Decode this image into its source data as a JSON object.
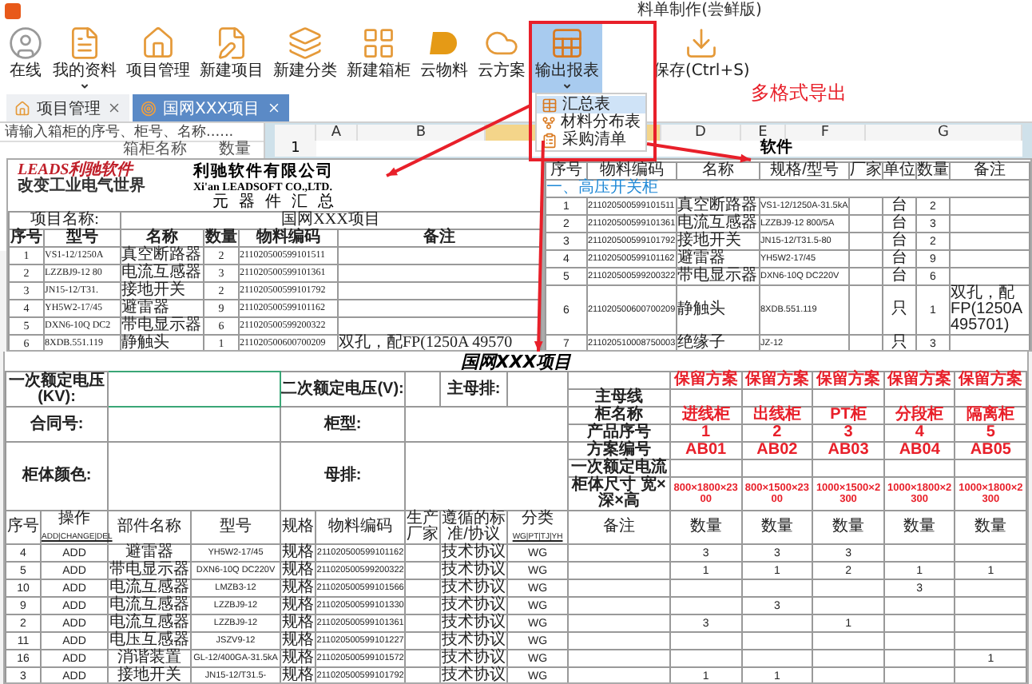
{
  "window": {
    "title": "料单制作(尝鲜版)"
  },
  "toolbar": [
    {
      "label": "在线",
      "dropdown": false,
      "selected": false
    },
    {
      "label": "我的资料",
      "dropdown": true,
      "selected": false
    },
    {
      "label": "项目管理",
      "dropdown": false,
      "selected": false
    },
    {
      "label": "新建项目",
      "dropdown": false,
      "selected": false
    },
    {
      "label": "新建分类",
      "dropdown": false,
      "selected": false
    },
    {
      "label": "新建箱柜",
      "dropdown": false,
      "selected": false
    },
    {
      "label": "云物料",
      "dropdown": false,
      "selected": false
    },
    {
      "label": "云方案",
      "dropdown": false,
      "selected": false
    },
    {
      "label": "输出报表",
      "dropdown": true,
      "selected": true
    },
    {
      "label": "保存(Ctrl+S)",
      "dropdown": false,
      "selected": false
    }
  ],
  "export_menu": [
    {
      "label": "汇总表",
      "selected": true
    },
    {
      "label": "材料分布表",
      "selected": false
    },
    {
      "label": "采购清单",
      "selected": false
    }
  ],
  "annotation": "多格式导出",
  "tabs": [
    {
      "label": "项目管理",
      "selected": false
    },
    {
      "label": "国网XXX项目",
      "selected": true
    }
  ],
  "cabinet_panel": {
    "search": {
      "placeholder": "请输入箱柜的序号、柜号、名称......"
    },
    "columns": [
      "箱柜名称",
      "数量"
    ]
  },
  "sheet": {
    "columns": [
      {
        "label": "A",
        "selected": false
      },
      {
        "label": "B",
        "selected": false
      },
      {
        "selected": true
      },
      {
        "label": "D",
        "selected": false
      },
      {
        "label": "E",
        "selected": false
      },
      {
        "label": "F",
        "selected": false
      },
      {
        "label": "G",
        "selected": false
      }
    ],
    "row_number": "1",
    "cell_text": "软件"
  },
  "summary_doc": {
    "logo": "LEADS利驰软件",
    "slogan": "改变工业电气世界",
    "company": "利驰软件有限公司",
    "company_en": "Xi'an LEADSOFT CO.,LTD.",
    "title": "元 器 件 汇 总",
    "project_label": "项目名称:",
    "project": "国网XXX项目",
    "columns": [
      "序号",
      "型号",
      "名称",
      "数量",
      "物料编码",
      "备注"
    ],
    "rows": [
      {
        "no": "1",
        "model": "VS1-12/1250A",
        "name": "真空断路器",
        "qty": "2",
        "code": "211020500599101511"
      },
      {
        "no": "2",
        "model": "LZZBJ9-12 80",
        "name": "电流互感器",
        "qty": "3",
        "code": "211020500599101361"
      },
      {
        "no": "3",
        "model": "JN15-12/T31.",
        "name": "接地开关",
        "qty": "2",
        "code": "211020500599101792"
      },
      {
        "no": "4",
        "model": "YH5W2-17/45",
        "name": "避雷器",
        "qty": "9",
        "code": "211020500599101162"
      },
      {
        "no": "5",
        "model": "DXN6-10Q DC2",
        "name": "带电显示器",
        "qty": "6",
        "code": "211020500599200322"
      },
      {
        "no": "6",
        "model": "8XDB.551.119",
        "name": "静触头",
        "qty": "1",
        "code": "211020500600700209",
        "note": "双孔，配FP(1250A 49570"
      }
    ]
  },
  "distribution_doc": {
    "columns": [
      "序号",
      "物料编码",
      "名称",
      "规格/型号",
      "厂家",
      "单位",
      "数量",
      "备注"
    ],
    "section": "一、高压开关柜",
    "rows": [
      {
        "no": "1",
        "code": "211020500599101511",
        "name": "真空断路器",
        "model": "VS1-12/1250A-31.5kA",
        "unit": "台",
        "qty": "2"
      },
      {
        "no": "2",
        "code": "211020500599101361",
        "name": "电流互感器",
        "model": "LZZBJ9-12 800/5A",
        "unit": "台",
        "qty": "3"
      },
      {
        "no": "3",
        "code": "211020500599101792",
        "name": "接地开关",
        "model": "JN15-12/T31.5-80",
        "unit": "台",
        "qty": "2"
      },
      {
        "no": "4",
        "code": "211020500599101162",
        "name": "避雷器",
        "model": "YH5W2-17/45",
        "unit": "台",
        "qty": "9"
      },
      {
        "no": "5",
        "code": "211020500599200322",
        "name": "带电显示器",
        "model": "DXN6-10Q DC220V",
        "unit": "台",
        "qty": "6"
      },
      {
        "no": "6",
        "code": "211020500600700209",
        "name": "静触头",
        "model": "8XDB.551.119",
        "unit": "只",
        "qty": "1",
        "note": "双孔，配FP(1250A 495701)"
      },
      {
        "no": "7",
        "code": "211020510008750003",
        "name": "绝缘子",
        "model": "JZ-12",
        "unit": "只",
        "qty": "3"
      }
    ]
  },
  "purchase_doc": {
    "title": "国网XXX项目",
    "info": [
      [
        "一次额定电压(KV):",
        "二次额定电压(V):",
        "主母排:"
      ],
      [
        "合同号:",
        "柜型:"
      ],
      [
        "柜体颜色:",
        "母排:"
      ]
    ],
    "schemes": [
      "保留方案",
      "保留方案",
      "保留方案",
      "保留方案",
      "保留方案"
    ],
    "spec_rows": [
      {
        "label": "主母线",
        "values": []
      },
      {
        "label": "柜名称",
        "values": [
          "进线柜",
          "出线柜",
          "PT柜",
          "分段柜",
          "隔离柜"
        ]
      },
      {
        "label": "产品序号",
        "values": [
          "1",
          "2",
          "3",
          "4",
          "5"
        ]
      },
      {
        "label": "方案编号",
        "values": [
          "AB01",
          "AB02",
          "AB03",
          "AB04",
          "AB05"
        ]
      },
      {
        "label": "一次额定电流",
        "values": []
      },
      {
        "label": "柜体尺寸 宽×深×高",
        "values": [
          "800×1800×2300",
          "800×1500×2300",
          "1000×1500×2300",
          "1000×1800×2300",
          "1000×1800×2300"
        ]
      }
    ],
    "columns": [
      "序号",
      "操作",
      "ADD|CHANGE|DEL",
      "部件名称",
      "型号",
      "规格",
      "物料编码",
      "生产厂家",
      "遵循的标准/协议",
      "分类",
      "WG|PT|TJ|YH",
      "备注",
      "数量",
      "数量",
      "数量",
      "数量",
      "数量"
    ],
    "rows": [
      {
        "no": "4",
        "op": "ADD",
        "name": "避雷器",
        "model": "YH5W2-17/45",
        "spec": "规格",
        "code": "211020500599101162",
        "standard": "技术协议",
        "category": "WG",
        "qty": {
          "s1": "3",
          "s2": "3",
          "s3": "3"
        }
      },
      {
        "no": "5",
        "op": "ADD",
        "name": "带电显示器",
        "model": "DXN6-10Q DC220V",
        "spec": "规格",
        "code": "211020500599200322",
        "standard": "技术协议",
        "category": "WG",
        "qty": {
          "s1": "1",
          "s2": "1",
          "s3": "2",
          "s4": "1",
          "s5": "1"
        }
      },
      {
        "no": "10",
        "op": "ADD",
        "name": "电流互感器",
        "model": "LMZB3-12",
        "spec": "规格",
        "code": "211020500599101566",
        "standard": "技术协议",
        "category": "WG",
        "qty": {
          "s4": "3"
        }
      },
      {
        "no": "9",
        "op": "ADD",
        "name": "电流互感器",
        "model": "LZZBJ9-12",
        "spec": "规格",
        "code": "211020500599101330",
        "standard": "技术协议",
        "category": "WG",
        "qty": {
          "s2": "3"
        }
      },
      {
        "no": "2",
        "op": "ADD",
        "name": "电流互感器",
        "model": "LZZBJ9-12",
        "spec": "规格",
        "code": "211020500599101361",
        "standard": "技术协议",
        "category": "WG",
        "qty": {
          "s1": "3",
          "s3": "1"
        }
      },
      {
        "no": "11",
        "op": "ADD",
        "name": "电压互感器",
        "model": "JSZV9-12",
        "spec": "规格",
        "code": "211020500599101227",
        "standard": "技术协议",
        "category": "WG",
        "qty": {}
      },
      {
        "no": "16",
        "op": "ADD",
        "name": "消谐装置",
        "model": "GL-12/400GA-31.5kA",
        "spec": "规格",
        "code": "211020500599101572",
        "standard": "技术协议",
        "category": "WG",
        "qty": {
          "s5": "1"
        }
      },
      {
        "no": "3",
        "op": "ADD",
        "name": "接地开关",
        "model": "JN15-12/T31.5-",
        "spec": "规格",
        "code": "211020500599101792",
        "standard": "技术协议",
        "category": "WG",
        "qty": {
          "s1": "1",
          "s2": "1"
        }
      }
    ]
  }
}
